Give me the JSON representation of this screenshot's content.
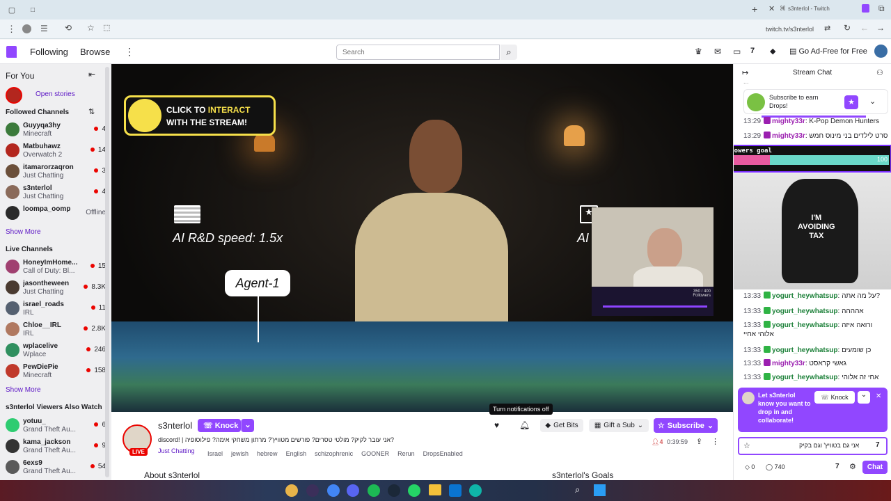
{
  "browser": {
    "tab_title": "s3nterlol - Twitch",
    "url": "twitch.tv/s3nterlol"
  },
  "twitch_nav": {
    "following": "Following",
    "browse": "Browse",
    "search_placeholder": "Search",
    "ad_free": "Go Ad-Free for Free"
  },
  "sidebar": {
    "for_you": "For You",
    "open_stories": "Open stories",
    "followed_header": "Followed Channels",
    "followed": [
      {
        "name": "Guyyqa3hy",
        "game": "Minecraft",
        "count": "4",
        "color": "#3b7a3b"
      },
      {
        "name": "Matbuhawz",
        "game": "Overwatch 2",
        "count": "14",
        "color": "#b3261e"
      },
      {
        "name": "itamarorzaqron",
        "game": "Just Chatting",
        "count": "3",
        "color": "#6b4f3a"
      },
      {
        "name": "s3nterlol",
        "game": "Just Chatting",
        "count": "4",
        "color": "#8a6a5a"
      },
      {
        "name": "loompa_oomp",
        "game": "",
        "count": "Offline",
        "color": "#2a2a2a"
      }
    ],
    "show_more_1": "Show More",
    "live_header": "Live Channels",
    "live": [
      {
        "name": "HoneyImHome...",
        "game": "Call of Duty: Bl...",
        "count": "15",
        "color": "#a04070"
      },
      {
        "name": "jasontheween",
        "game": "Just Chatting",
        "count": "8.3K",
        "color": "#4a3a30"
      },
      {
        "name": "israel_roads",
        "game": "IRL",
        "count": "11",
        "color": "#556070"
      },
      {
        "name": "Chloe__IRL",
        "game": "IRL",
        "count": "2.8K",
        "color": "#b07860"
      },
      {
        "name": "wplacelive",
        "game": "Wplace",
        "count": "246",
        "color": "#2f8f5f"
      },
      {
        "name": "PewDiePie",
        "game": "Minecraft",
        "count": "158",
        "color": "#c0392b"
      }
    ],
    "show_more_2": "Show More",
    "also_header": "s3nterlol Viewers Also Watch",
    "also": [
      {
        "name": "yotuu_",
        "game": "Grand Theft Au...",
        "count": "6",
        "color": "#2ecc71"
      },
      {
        "name": "kama_jackson",
        "game": "Grand Theft Au...",
        "count": "9",
        "color": "#333333"
      },
      {
        "name": "6exs9",
        "game": "Grand Theft Au...",
        "count": "54",
        "color": "#5a5a5a"
      }
    ]
  },
  "player": {
    "interact_line1": "CLICK TO",
    "interact_highlight": "INTERACT",
    "interact_line2": "WITH THE STREAM!",
    "speed_label": "AI R&D speed: 1.5x",
    "agent_label": "Agent-1",
    "ai_label": "AI",
    "cam_bar_right": "350 / 400 Followers"
  },
  "stream_info": {
    "channel": "s3nterlol",
    "knock": "Knock",
    "title": "discord! | אני עובר לקיק? מולטי טסרים? פורשים מטוויץ'? מרתון משחקי אימה? פילוסופיה?",
    "game": "Just Chatting",
    "tags": [
      "Israel",
      "jewish",
      "hebrew",
      "English",
      "schizophrenic",
      "GOONER",
      "Rerun",
      "DropsEnabled"
    ],
    "live_badge": "LIVE",
    "tooltip": "Turn notifications off",
    "get_bits": "Get Bits",
    "gift_sub": "Gift a Sub",
    "subscribe": "Subscribe",
    "viewers": "4",
    "uptime": "0:39:59",
    "about": "About s3nterlol",
    "goals": "s3nterlol's Goals"
  },
  "chat": {
    "header": "Stream Chat",
    "drops_text": "Subscribe to earn Drops!",
    "top_line": "...",
    "messages_top": [
      {
        "time": "13:29",
        "user": "mighty33r",
        "text": ": K-Pop Demon Hunters",
        "color": "#9b1fb0",
        "badge": "#9b1fb0"
      },
      {
        "time": "13:29",
        "user": "mighty33r",
        "text": ": סרט לילדים בני מינוס חמש",
        "color": "#9b1fb0",
        "badge": "#9b1fb0"
      }
    ],
    "goal_title": "Followers goal",
    "goal_current": "30",
    "goal_target": "100",
    "goal_fraction": 0.3,
    "messages_bottom": [
      {
        "time": "13:33",
        "user": "yogurt_heywhatsup",
        "text": ": על מה אתה?",
        "color": "#1a7f37",
        "badge": "#2fb344"
      },
      {
        "time": "13:33",
        "user": "yogurt_heywhatsup",
        "text": ": אהההה",
        "color": "#1a7f37",
        "badge": "#2fb344"
      },
      {
        "time": "13:33",
        "user": "yogurt_heywhatsup",
        "text": ": ורואה איזה",
        "color": "#1a7f37",
        "badge": "#2fb344"
      },
      {
        "time": "",
        "user": "",
        "text": "אלוהי אחיי",
        "color": "#1f1f23",
        "badge": ""
      },
      {
        "time": "13:33",
        "user": "yogurt_heywhatsup",
        "text": ": כן שומעים",
        "color": "#1a7f37",
        "badge": "#2fb344"
      },
      {
        "time": "13:33",
        "user": "mighty33r",
        "text": ": גאשי קראסט",
        "color": "#9b1fb0",
        "badge": "#9b1fb0"
      },
      {
        "time": "13:33",
        "user": "yogurt_heywhatsup",
        "text": ": אחי זה אלוהי",
        "color": "#1a7f37",
        "badge": "#2fb344"
      }
    ],
    "knock_card_text": "Let s3nterlol know you want to drop in and collaborate!",
    "knock_btn": "Knock",
    "input_value": "אני גם בטוויץ' וגם בקיק",
    "points": "0",
    "points_2": "740",
    "chat_btn": "Chat"
  },
  "colors": {
    "twitch_purple": "#9147ff",
    "live_red": "#eb0400"
  }
}
